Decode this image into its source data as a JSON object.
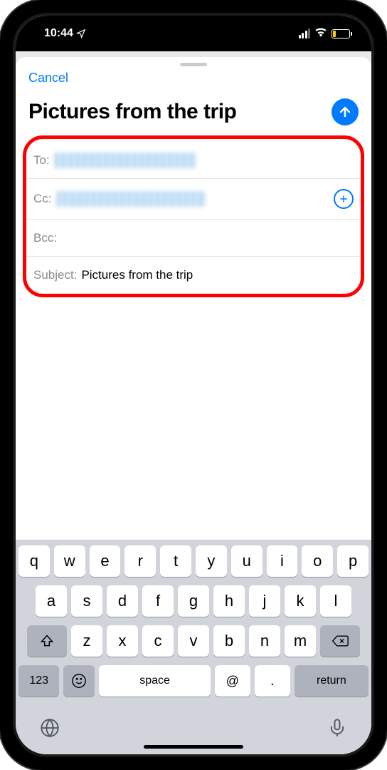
{
  "status": {
    "time": "10:44",
    "location_glyph": "↗"
  },
  "compose": {
    "cancel": "Cancel",
    "title": "Pictures from the trip",
    "labels": {
      "to": "To:",
      "cc": "Cc:",
      "bcc": "Bcc:",
      "subject": "Subject:"
    },
    "subject_value": "Pictures from the trip"
  },
  "keyboard": {
    "row1": [
      "q",
      "w",
      "e",
      "r",
      "t",
      "y",
      "u",
      "i",
      "o",
      "p"
    ],
    "row2": [
      "a",
      "s",
      "d",
      "f",
      "g",
      "h",
      "j",
      "k",
      "l"
    ],
    "row3": [
      "z",
      "x",
      "c",
      "v",
      "b",
      "n",
      "m"
    ],
    "numbers_key": "123",
    "space": "space",
    "at": "@",
    "dot": ".",
    "return": "return"
  }
}
